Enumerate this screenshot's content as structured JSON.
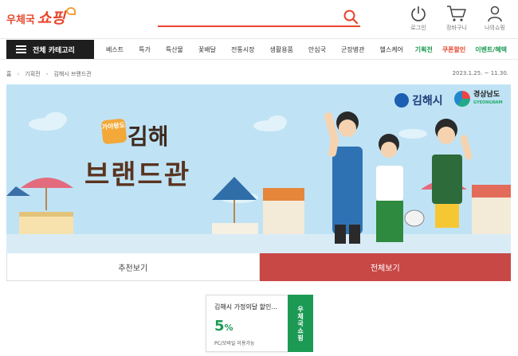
{
  "header": {
    "logo_small": "우체국",
    "logo_big": "쇼핑",
    "search_placeholder": "",
    "icons": [
      {
        "name": "power-icon",
        "label": "로그인"
      },
      {
        "name": "cart-icon",
        "label": "장바구니"
      },
      {
        "name": "person-icon",
        "label": "나의쇼핑"
      }
    ]
  },
  "nav": {
    "all_categories": "전체 카테고리",
    "items": [
      "베스트",
      "특가",
      "특산물",
      "꽃배달",
      "전통시장",
      "생활용품",
      "안심국",
      "군장병관",
      "헬스케어"
    ],
    "right_items": [
      {
        "label": "기획전",
        "color": "#1c9a54"
      },
      {
        "label": "쿠폰할인",
        "color": "#e8452c"
      },
      {
        "label": "이벤트/혜택",
        "color": "#1c9a54"
      }
    ]
  },
  "breadcrumb": {
    "home": "홈",
    "level1": "기획전",
    "level2": "김해시 브랜드관",
    "period": "2023.1.25. ~ 11.30."
  },
  "banner": {
    "badge": "가야왕도",
    "city": "김해",
    "brand": "브랜드관",
    "logo_gimhae": "김해시",
    "logo_gn": "경상남도",
    "logo_gn_sub": "GYEONGNAM"
  },
  "tabs": {
    "recommend": "추천보기",
    "all": "전체보기"
  },
  "coupon": {
    "title": "김해시 가정의달 할인...",
    "rate": "5",
    "unit": "%",
    "note": "PC/모바일 이용가능",
    "stamp": "우체국쇼핑"
  },
  "colors": {
    "brand_red": "#e8452c",
    "accent_green": "#1c9a54",
    "tab_active": "#c84846",
    "banner_sky": "#bfe3f5"
  }
}
